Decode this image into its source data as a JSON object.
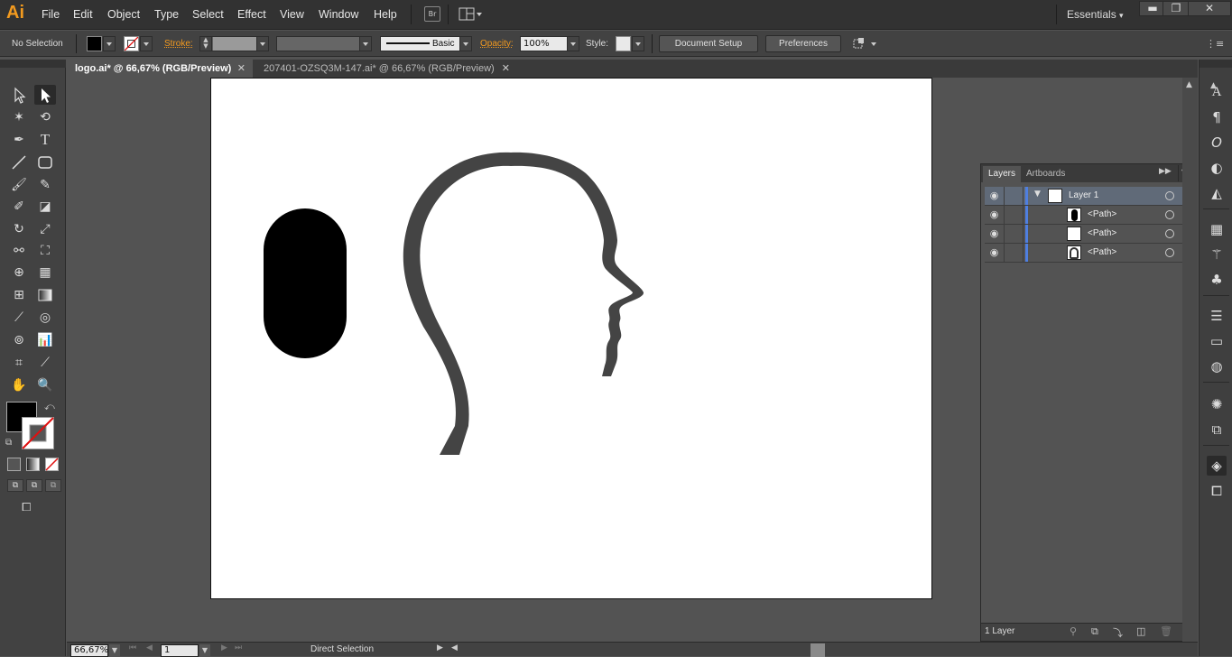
{
  "app": {
    "logo": "Ai"
  },
  "menu": [
    "File",
    "Edit",
    "Object",
    "Type",
    "Select",
    "Effect",
    "View",
    "Window",
    "Help"
  ],
  "bridge_button": "Br",
  "workspace": "Essentials",
  "window_controls": {
    "minimize": "▬",
    "restore": "❐",
    "close": "✕"
  },
  "control": {
    "selection": "No Selection",
    "stroke_label": "Stroke:",
    "brush": "Basic",
    "opacity_label": "Opacity:",
    "opacity_value": "100%",
    "style_label": "Style:",
    "document_setup": "Document Setup",
    "preferences": "Preferences"
  },
  "tabs": [
    {
      "label": "logo.ai* @ 66,67% (RGB/Preview)",
      "close": "✕"
    },
    {
      "label": "207401-OZSQ3M-147.ai* @ 66,67% (RGB/Preview)",
      "close": "✕"
    }
  ],
  "layers_panel": {
    "tabs": [
      "Layers",
      "Artboards"
    ],
    "rows": [
      {
        "name": "Layer 1"
      },
      {
        "name": "<Path>"
      },
      {
        "name": "<Path>"
      },
      {
        "name": "<Path>"
      }
    ],
    "footer": "1 Layer"
  },
  "status": {
    "zoom": "66,67%",
    "artboard": "1",
    "tool": "Direct Selection"
  },
  "colors": {
    "accent": "#f29a1f",
    "head": "#444444",
    "layer_bar": "#4f7fe0"
  }
}
